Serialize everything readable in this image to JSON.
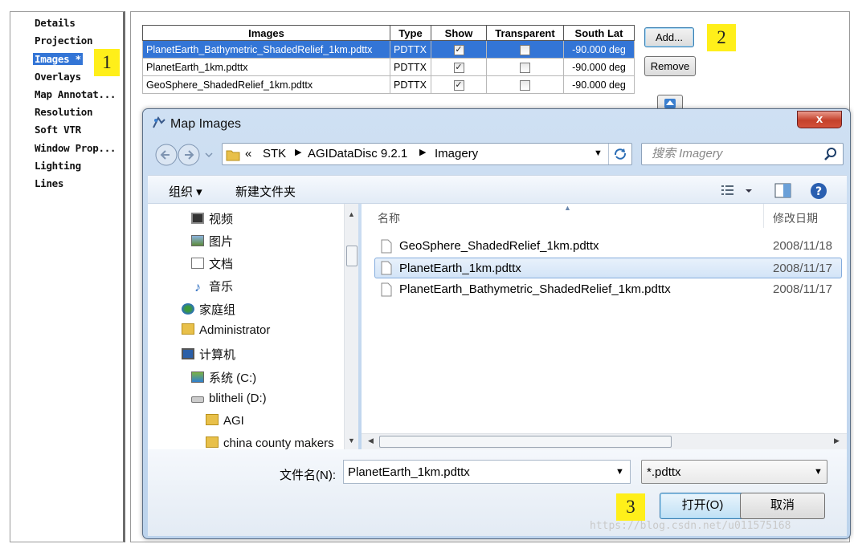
{
  "nav": {
    "items": [
      "Details",
      "Projection",
      "Images *",
      "Overlays",
      "Map Annotat...",
      "Resolution",
      "Soft VTR",
      "Window Prop...",
      "Lighting",
      "Lines"
    ],
    "selected_index": 2
  },
  "callouts": [
    "1",
    "2",
    "3"
  ],
  "images_table": {
    "headers": [
      "Images",
      "Type",
      "Show",
      "Transparent",
      "South Lat"
    ],
    "rows": [
      {
        "name": "PlanetEarth_Bathymetric_ShadedRelief_1km.pdttx",
        "type": "PDTTX",
        "show": true,
        "transparent": false,
        "south_lat": "-90.000 deg"
      },
      {
        "name": "PlanetEarth_1km.pdttx",
        "type": "PDTTX",
        "show": true,
        "transparent": false,
        "south_lat": "-90.000 deg"
      },
      {
        "name": "GeoSphere_ShadedRelief_1km.pdttx",
        "type": "PDTTX",
        "show": true,
        "transparent": false,
        "south_lat": "-90.000 deg"
      }
    ],
    "selected_row": 0
  },
  "buttons": {
    "add": "Add...",
    "remove": "Remove"
  },
  "dialog": {
    "title": "Map Images",
    "close_glyph": "x",
    "breadcrumb": {
      "prefix": "«",
      "parts": [
        "STK",
        "AGIDataDisc 9.2.1",
        "Imagery"
      ]
    },
    "search_placeholder": "搜索 Imagery",
    "toolbar": {
      "organize": "组织 ▾",
      "new_folder": "新建文件夹"
    },
    "tree": [
      {
        "label": "视频",
        "icon": "video-icon"
      },
      {
        "label": "图片",
        "icon": "pictures-icon"
      },
      {
        "label": "文档",
        "icon": "documents-icon"
      },
      {
        "label": "音乐",
        "icon": "music-icon"
      },
      {
        "label": "家庭组",
        "icon": "homegroup-icon"
      },
      {
        "label": "Administrator",
        "icon": "user-folder-icon"
      },
      {
        "label": "计算机",
        "icon": "computer-icon"
      },
      {
        "label": "系统 (C:)",
        "icon": "drive-c-icon"
      },
      {
        "label": "blitheli (D:)",
        "icon": "drive-d-icon"
      },
      {
        "label": "AGI",
        "icon": "folder-icon"
      },
      {
        "label": "china county makers",
        "icon": "folder-icon"
      }
    ],
    "columns": {
      "name": "名称",
      "modified": "修改日期"
    },
    "files": [
      {
        "name": "GeoSphere_ShadedRelief_1km.pdttx",
        "date": "2008/11/18"
      },
      {
        "name": "PlanetEarth_1km.pdttx",
        "date": "2008/11/17"
      },
      {
        "name": "PlanetEarth_Bathymetric_ShadedRelief_1km.pdttx",
        "date": "2008/11/17"
      }
    ],
    "selected_file": 1,
    "filename_label": "文件名(N):",
    "filename_value": "PlanetEarth_1km.pdttx",
    "filter_value": "*.pdttx",
    "open_button": "打开(O)",
    "cancel_button": "取消"
  },
  "watermark": "https://blog.csdn.net/u011575168",
  "colors": {
    "selection": "#3375d6",
    "callout": "#ffef1a",
    "close": "#c4412b"
  }
}
